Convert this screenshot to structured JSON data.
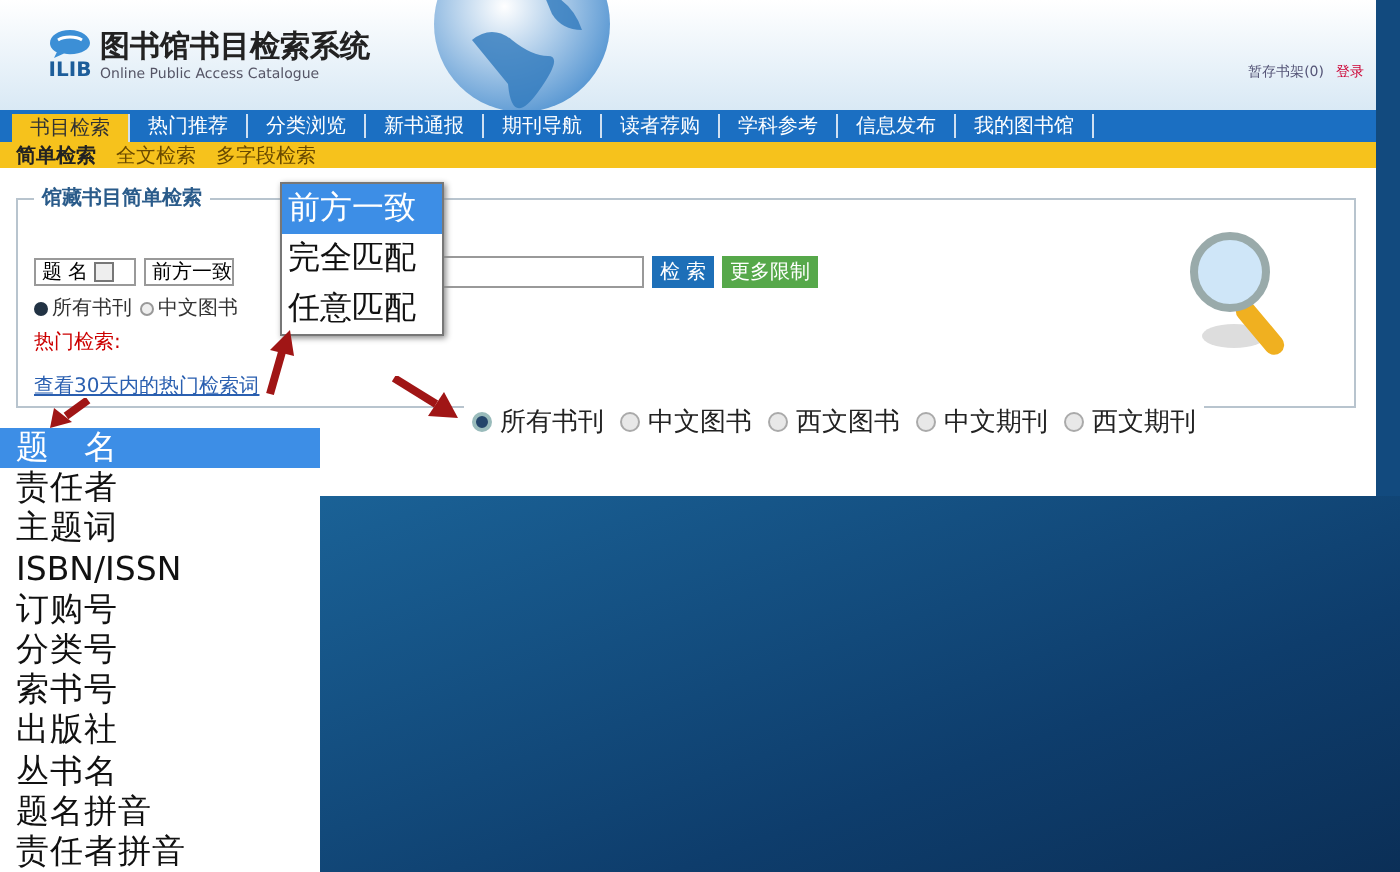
{
  "header": {
    "logo_text": "ILIB",
    "title": "图书馆书目检索系统",
    "subtitle": "Online Public Access Catalogue",
    "links": [
      "暂存书架(0)",
      "登录"
    ]
  },
  "nav": {
    "tabs": [
      {
        "label": "书目检索",
        "selected": true
      },
      {
        "label": "热门推荐",
        "selected": false
      },
      {
        "label": "分类浏览",
        "selected": false
      },
      {
        "label": "新书通报",
        "selected": false
      },
      {
        "label": "期刊导航",
        "selected": false
      },
      {
        "label": "读者荐购",
        "selected": false
      },
      {
        "label": "学科参考",
        "selected": false
      },
      {
        "label": "信息发布",
        "selected": false
      },
      {
        "label": "我的图书馆",
        "selected": false
      }
    ]
  },
  "sub_tabs": [
    {
      "label": "简单检索",
      "selected": true
    },
    {
      "label": "全文检索",
      "selected": false
    },
    {
      "label": "多字段检索",
      "selected": false
    }
  ],
  "search_panel": {
    "legend": "馆藏书目简单检索",
    "field_select": "题 名",
    "match_select": "前方一致",
    "search_button": "检 索",
    "more_button": "更多限制",
    "radios": [
      {
        "label": "所有书刊",
        "selected": true
      },
      {
        "label": "中文图书",
        "selected": false
      }
    ],
    "hot_label": "热门检索:",
    "hot_link": "查看30天内的热门检索词"
  },
  "match_popup": {
    "options": [
      {
        "label": "前方一致",
        "selected": true
      },
      {
        "label": "完全匹配",
        "selected": false
      },
      {
        "label": "任意匹配",
        "selected": false
      }
    ]
  },
  "type_radios_zoom": [
    {
      "label": "所有书刊",
      "selected": true
    },
    {
      "label": "中文图书",
      "selected": false
    },
    {
      "label": "西文图书",
      "selected": false
    },
    {
      "label": "中文期刊",
      "selected": false
    },
    {
      "label": "西文期刊",
      "selected": false
    }
  ],
  "field_list_zoom": {
    "options": [
      {
        "label": "题　名",
        "selected": true
      },
      {
        "label": "责任者",
        "selected": false
      },
      {
        "label": "主题词",
        "selected": false
      },
      {
        "label": "ISBN/ISSN",
        "selected": false
      },
      {
        "label": "订购号",
        "selected": false
      },
      {
        "label": "分类号",
        "selected": false
      },
      {
        "label": "索书号",
        "selected": false
      },
      {
        "label": "出版社",
        "selected": false
      },
      {
        "label": "丛书名",
        "selected": false
      },
      {
        "label": "题名拼音",
        "selected": false
      },
      {
        "label": "责任者拼音",
        "selected": false
      }
    ]
  }
}
